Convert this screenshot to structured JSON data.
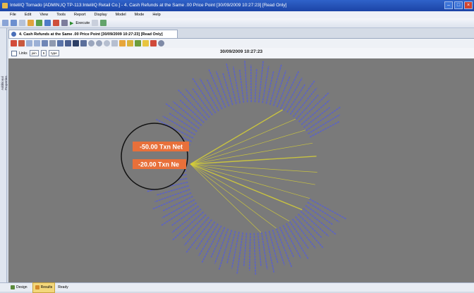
{
  "window": {
    "title": "InteliIQ Tornado [ADMIN,IQ TP-113:InteliIQ Retail Co.] - 4. Cash Refunds at the Same .00 Price Point [30/09/2009 10:27:23] [Read Only]"
  },
  "menu": [
    "File",
    "Edit",
    "View",
    "Tools",
    "Report",
    "Display",
    "Model",
    "Mode",
    "Help"
  ],
  "toolbar": {
    "execute_label": "Execute"
  },
  "left_panel": {
    "label": "Additional Properties"
  },
  "doc_tab": {
    "label": "4. Cash Refunds at the Same .00 Price Point [30/09/2009 10:27:23] [Read Only]"
  },
  "filter_bar": {
    "checkbox_label": "Links",
    "field1": "join",
    "field2": "5",
    "field3": "type"
  },
  "timestamp": "30/09/2009 10:27:23",
  "magnifier": {
    "labels": [
      "-50.00 Txn Net",
      "-20.00 Txn Ne"
    ]
  },
  "colors": {
    "canvas": "#7a7a7a",
    "node_text": "#5c63c6",
    "link": "#d6cf36",
    "highlight": "#e8703a"
  },
  "status": {
    "design_label": "Design",
    "results_label": "Results",
    "state": "Ready"
  }
}
